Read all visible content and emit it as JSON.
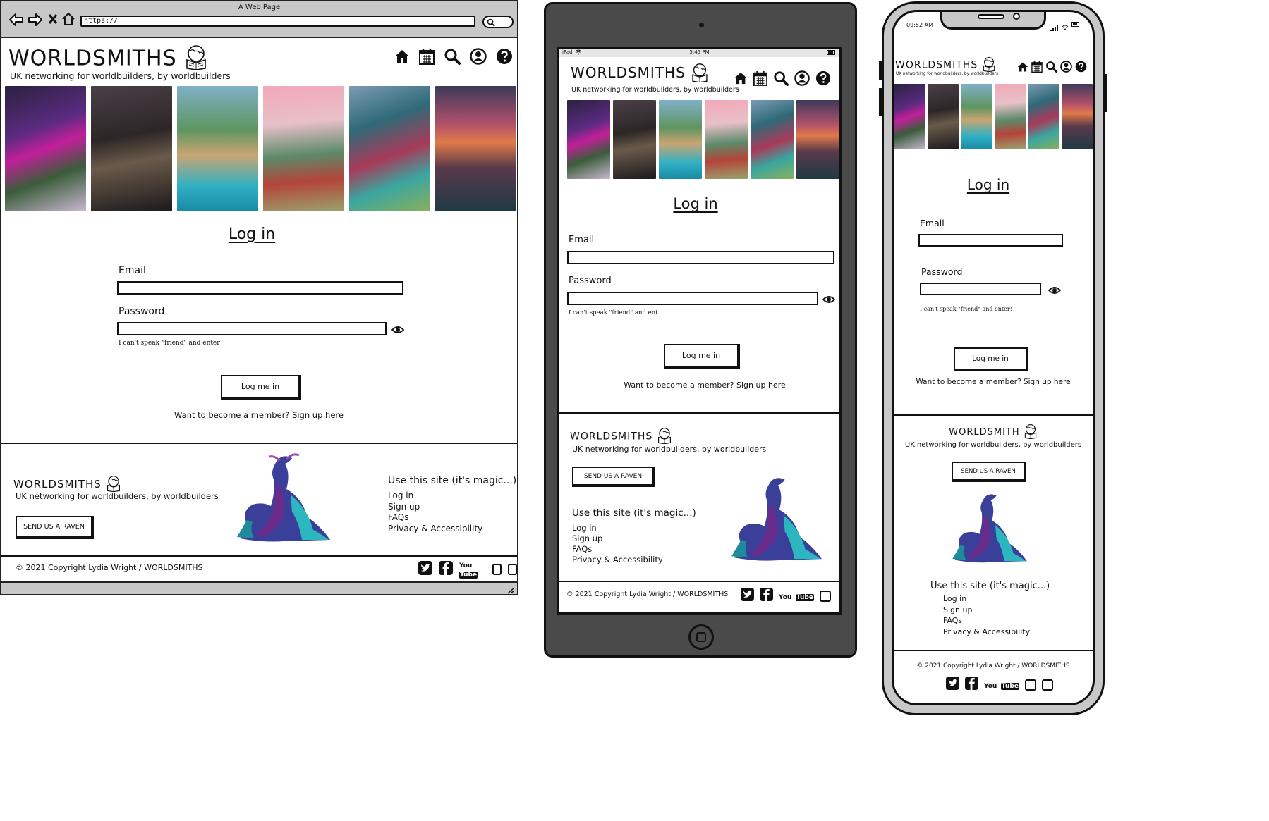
{
  "browser": {
    "window_title": "A Web Page",
    "url": "https://"
  },
  "site": {
    "logo": "WORLDSMITHS",
    "tagline": "UK networking for worldbuilders, by worldbuilders",
    "nav_icons": [
      "home-icon",
      "calendar-icon",
      "search-icon",
      "account-icon",
      "help-icon"
    ]
  },
  "login": {
    "heading": "Log in",
    "email_label": "Email",
    "password_label": "Password",
    "password_hint": "I can't speak \"friend\" and enter!",
    "password_hint_tablet": "I can't speak \"friend\" and ent",
    "submit_label": "Log me in",
    "signup_line": "Want to become a member? Sign up here"
  },
  "footer": {
    "logo": "WORLDSMITHS",
    "logo_mobile": "WORLDSMITH",
    "tagline": "UK networking for worldbuilders, by worldbuilders",
    "raven_button": "SEND US A RAVEN",
    "links_heading": "Use this site (it's magic...)",
    "links": [
      "Log in",
      "Sign up",
      "FAQs",
      "Privacy & Accessibility"
    ],
    "copyright": "© 2021 Copyright Lydia Wright / WORLDSMITHS",
    "social_icons": [
      "twitter-icon",
      "facebook-icon",
      "youtube-icon"
    ],
    "youtube_text": [
      "You",
      "Tube"
    ]
  },
  "tablet": {
    "status_left": "iPad",
    "status_time": "5:45 PM"
  },
  "phone": {
    "status_time": "09:52 AM"
  },
  "colors": {
    "frame_dark": "#4a4a4a",
    "frame_gray": "#c8c8c8",
    "ink": "#111111"
  }
}
